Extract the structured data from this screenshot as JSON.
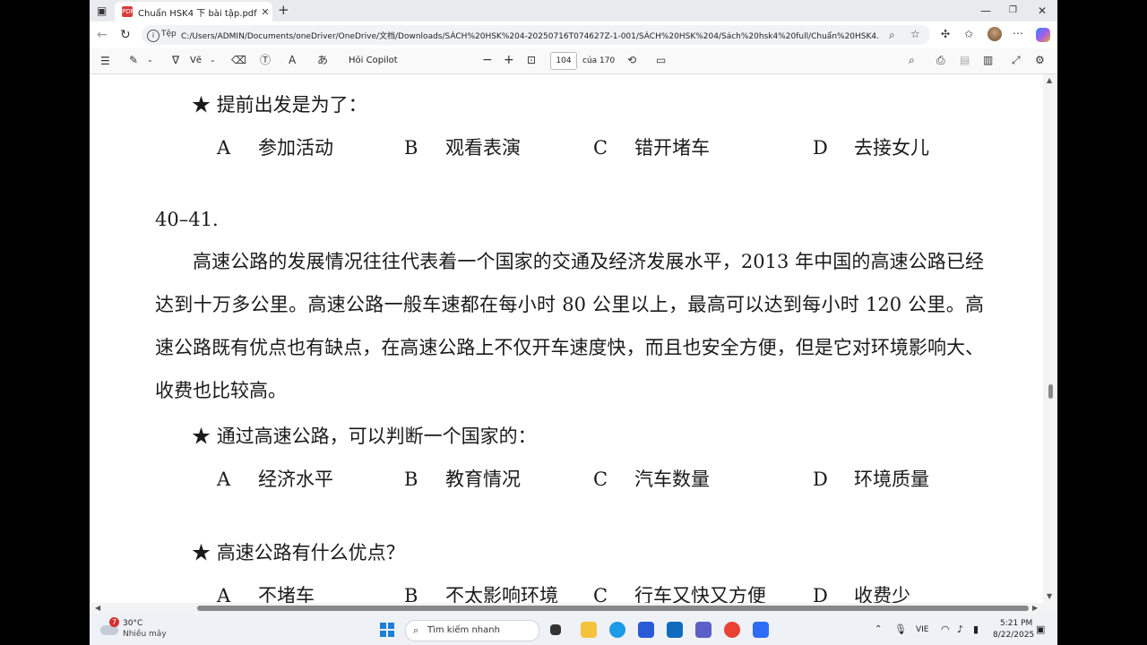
{
  "browser": {
    "tab_title": "Chuẩn HSK4 下 bài tập.pdf",
    "tab_icon": "PDF",
    "address_prefix": "Tệp",
    "url": "C:/Users/ADMIN/Documents/oneDriver/OneDrive/文档/Downloads/SÁCH%20HSK%204-20250716T074627Z-1-001/SÁCH%20HSK%204/Sách%20hsk4%20full/Chuẩn%20HSK4..."
  },
  "pdf_toolbar": {
    "draw_label": "Vẽ",
    "copilot_label": "Hỏi Copilot",
    "page_number": "104",
    "page_total": "của 170"
  },
  "document": {
    "q1": {
      "star": "★",
      "question": "提前出发是为了：",
      "options": [
        {
          "letter": "A",
          "text": "参加活动"
        },
        {
          "letter": "B",
          "text": "观看表演"
        },
        {
          "letter": "C",
          "text": "错开堵车"
        },
        {
          "letter": "D",
          "text": "去接女儿"
        }
      ]
    },
    "section": "40–41.",
    "passage": "高速公路的发展情况往往代表着一个国家的交通及经济发展水平，2013 年中国的高速公路已经达到十万多公里。高速公路一般车速都在每小时 80 公里以上，最高可以达到每小时 120 公里。高速公路既有优点也有缺点，在高速公路上不仅开车速度快，而且也安全方便，但是它对环境影响大、收费也比较高。",
    "q2": {
      "star": "★",
      "question": "通过高速公路，可以判断一个国家的：",
      "options": [
        {
          "letter": "A",
          "text": "经济水平"
        },
        {
          "letter": "B",
          "text": "教育情况"
        },
        {
          "letter": "C",
          "text": "汽车数量"
        },
        {
          "letter": "D",
          "text": "环境质量"
        }
      ]
    },
    "q3": {
      "star": "★",
      "question": "高速公路有什么优点？",
      "options": [
        {
          "letter": "A",
          "text": "不堵车"
        },
        {
          "letter": "B",
          "text": "不太影响环境"
        },
        {
          "letter": "C",
          "text": "行车又快又方便"
        },
        {
          "letter": "D",
          "text": "收费少"
        }
      ]
    }
  },
  "taskbar": {
    "weather_temp": "30°C",
    "weather_desc": "Nhiều mây",
    "weather_badge": "7",
    "search_placeholder": "Tìm kiếm nhanh",
    "language": "VIE",
    "time": "5:21 PM",
    "date": "8/22/2025"
  }
}
